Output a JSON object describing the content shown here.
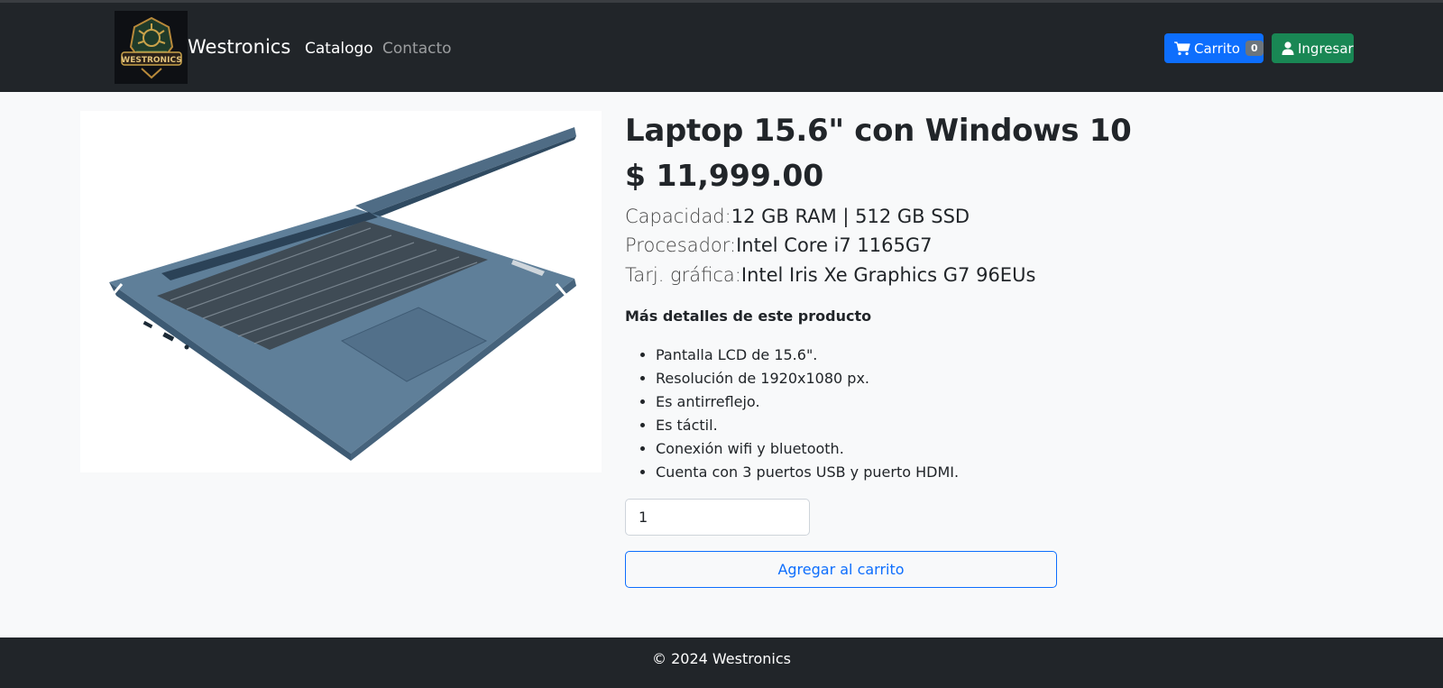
{
  "navbar": {
    "brand": "Westronics",
    "logo_text": "WESTRONICS",
    "links": [
      {
        "label": "Catalogo",
        "active": true
      },
      {
        "label": "Contacto",
        "active": false
      }
    ],
    "cart_label": "Carrito",
    "cart_count": "0",
    "login_label": "Ingresar",
    "icons": {
      "cart": "cart-icon",
      "user": "user-icon"
    }
  },
  "product": {
    "title": "Laptop 15.6\" con Windows 10",
    "price": "$ 11,999.00",
    "specs": [
      {
        "label": "Capacidad:",
        "value": "12 GB RAM | 512 GB SSD"
      },
      {
        "label": "Procesador:",
        "value": "Intel Core i7 1165G7"
      },
      {
        "label": "Tarj. gráfica:",
        "value": "Intel Iris Xe Graphics G7 96EUs"
      }
    ],
    "details_heading": "Más detalles de este producto",
    "details": [
      "Pantalla LCD de 15.6\".",
      "Resolución de 1920x1080 px.",
      "Es antirreflejo.",
      "Es táctil.",
      "Conexión wifi y bluetooth.",
      "Cuenta con 3 puertos USB y puerto HDMI."
    ],
    "quantity": "1",
    "add_to_cart_label": "Agregar al carrito"
  },
  "footer": {
    "text": "© 2024 Westronics"
  },
  "colors": {
    "navbar_bg": "#212529",
    "primary": "#0d6efd",
    "success": "#198754",
    "page_bg": "#f8f9fa"
  }
}
